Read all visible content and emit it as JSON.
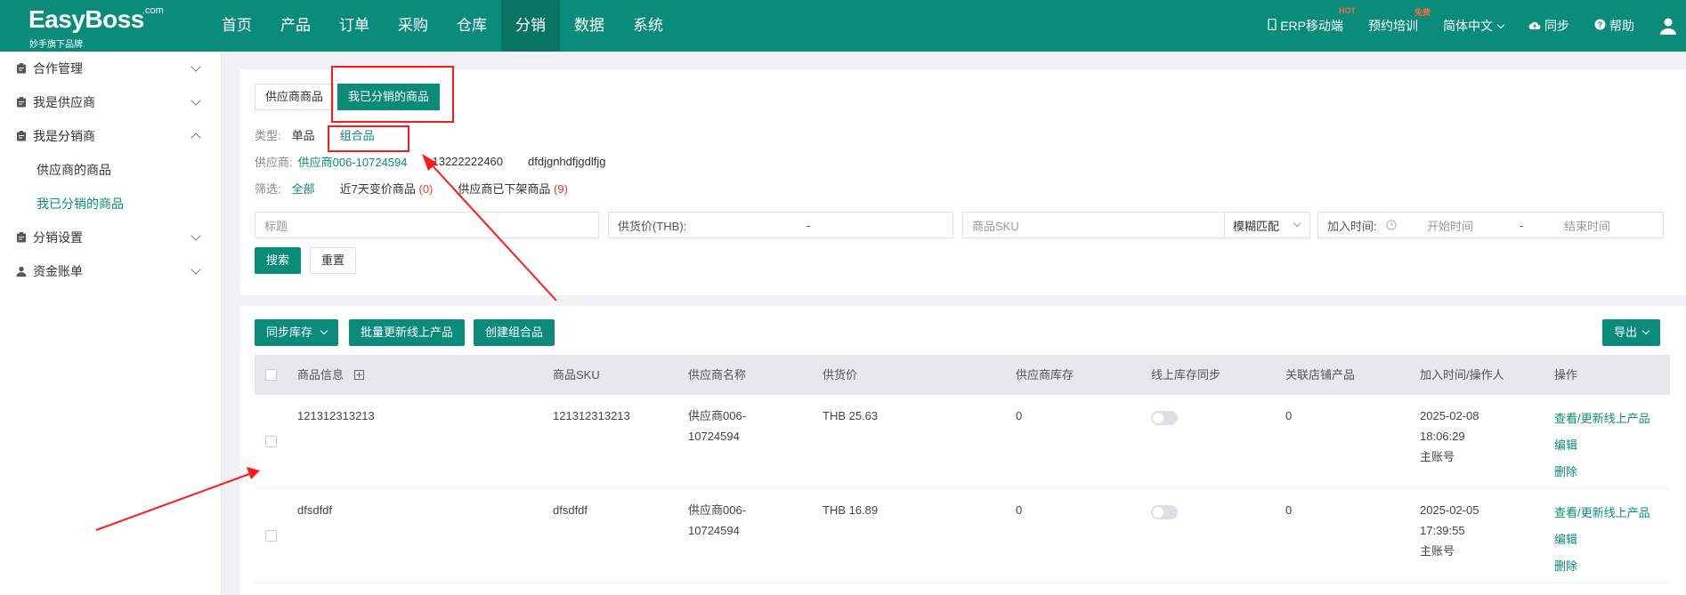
{
  "header": {
    "logo_text": "EasyBoss",
    "logo_com": ".com",
    "logo_sub": "妙手旗下品牌",
    "nav": [
      "首页",
      "产品",
      "订单",
      "采购",
      "仓库",
      "分销",
      "数据",
      "系统"
    ],
    "active_nav": "分销",
    "erp_mobile": "ERP移动端",
    "erp_badge": "HOT",
    "training": "预约培训",
    "training_badge": "免费",
    "language": "简体中文",
    "sync": "同步",
    "help": "帮助"
  },
  "sidebar": {
    "items": [
      {
        "label": "合作管理"
      },
      {
        "label": "我是供应商"
      },
      {
        "label": "我是分销商"
      },
      {
        "label": "分销设置"
      },
      {
        "label": "资金账单"
      }
    ],
    "subitems": [
      "供应商的商品",
      "我已分销的商品"
    ],
    "active_sub": "我已分销的商品"
  },
  "filter": {
    "tabs": [
      "供应商商品",
      "我已分销的商品"
    ],
    "active_tab": "我已分销的商品",
    "type_label": "类型:",
    "type_options": [
      "单品",
      "组合品"
    ],
    "supplier_label": "供应商:",
    "supplier_name": "供应商006-10724594",
    "supplier_phone": "13222222460",
    "supplier_code": "dfdjgnhdfjgdlfjg",
    "screen_label": "筛选:",
    "screen_all": "全部",
    "screen_price_change": "近7天变价商品",
    "screen_price_change_count": "(0)",
    "screen_delisted": "供应商已下架商品",
    "screen_delisted_count": "(9)",
    "title_placeholder": "标题",
    "price_label": "供货价(THB):",
    "range_dash": "-",
    "sku_placeholder": "商品SKU",
    "match_mode": "模糊匹配",
    "join_time_label": "加入时间:",
    "start_time": "开始时间",
    "end_time": "结束时间",
    "search_btn": "搜索",
    "reset_btn": "重置"
  },
  "toolbar": {
    "sync_stock": "同步库存",
    "batch_update": "批量更新线上产品",
    "create_combo": "创建组合品",
    "export": "导出"
  },
  "table": {
    "headers": [
      "商品信息",
      "商品SKU",
      "供应商名称",
      "供货价",
      "供应商库存",
      "线上库存同步",
      "关联店铺产品",
      "加入时间/操作人",
      "操作"
    ],
    "rows": [
      {
        "info": "121312313213",
        "sku": "121312313213",
        "supplier_line1": "供应商006-",
        "supplier_line2": "10724594",
        "price": "THB 25.63",
        "stock": "0",
        "sync_on": false,
        "linked": "0",
        "date": "2025-02-08",
        "time": "18:06:29",
        "operator": "主账号",
        "ops": [
          "查看/更新线上产品",
          "编辑",
          "删除"
        ]
      },
      {
        "info": "dfsdfdf",
        "sku": "dfsdfdf",
        "supplier_line1": "供应商006-",
        "supplier_line2": "10724594",
        "price": "THB 16.89",
        "stock": "0",
        "sync_on": false,
        "linked": "0",
        "date": "2025-02-05",
        "time": "17:39:55",
        "operator": "主账号",
        "ops": [
          "查看/更新线上产品",
          "编辑",
          "删除"
        ]
      }
    ]
  },
  "colors": {
    "brand": "#0b8c7a",
    "annotation": "#ff1a1a"
  }
}
